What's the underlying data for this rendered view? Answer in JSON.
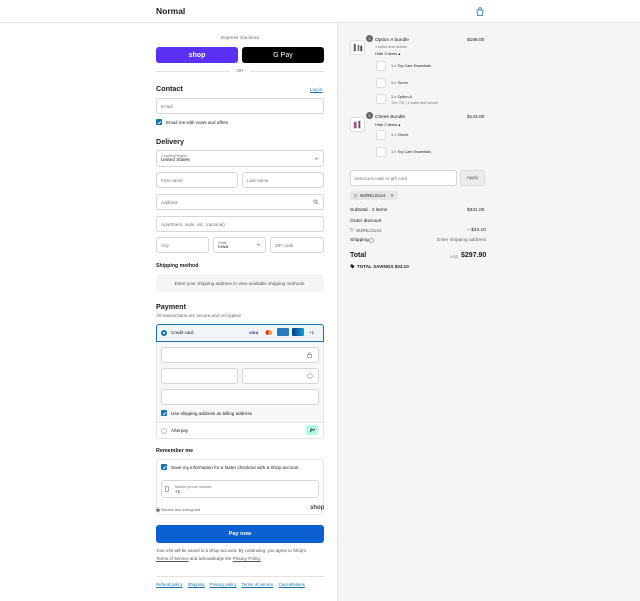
{
  "header": {
    "store_name": "Normal"
  },
  "express": {
    "label": "Express checkout",
    "shop_label": "shop",
    "gpay_label": "G Pay",
    "or_label": "OR"
  },
  "contact": {
    "title": "Contact",
    "login_label": "Log in",
    "email_placeholder": "Email",
    "news_label": "Email me with news and offers"
  },
  "delivery": {
    "title": "Delivery",
    "country_label": "Country/Region",
    "country_value": "United States",
    "first_name": "First name",
    "last_name": "Last name",
    "address": "Address",
    "apartment": "Apartment, suite, etc. (optional)",
    "city": "City",
    "state_label": "State",
    "state_value": "Iowa",
    "zip": "ZIP code"
  },
  "shipping": {
    "title": "Shipping method",
    "notice": "Enter your shipping address to view available shipping methods."
  },
  "payment": {
    "title": "Payment",
    "subtitle": "All transactions are secure and encrypted.",
    "credit_card_label": "Credit card",
    "visa": "VISA",
    "more_cards": "+1",
    "billing_label": "Use shipping address as billing address",
    "afterpay_label": "Afterpay"
  },
  "remember": {
    "title": "Remember me",
    "save_label": "Save my information for a faster checkout with a Shop account",
    "phone_label": "Mobile phone number",
    "phone_value": "+1",
    "secure_label": "Secure and encrypted",
    "shop_label": "shop"
  },
  "pay_button": "Pay now",
  "terms": {
    "line1": "Your info will be saved to a Shop account. By continuing, you agree to Shop's",
    "terms_link": "Terms of Service",
    "and_text": "and acknowledge the",
    "privacy_link": "Privacy Policy."
  },
  "footer_links": [
    "Refund policy",
    "Shipping",
    "Privacy policy",
    "Terms of service",
    "Cancellations"
  ],
  "summary": {
    "items": [
      {
        "name": "Option A bundle",
        "variant": "1 bullet and nehole",
        "toggle": "Hide 3 items",
        "price": "$188.00",
        "qty": "1",
        "sub_items": [
          {
            "text": "1 × Toy Care Essentials",
            "sub": ""
          },
          {
            "text": "1 × Gunm",
            "sub": ""
          },
          {
            "text": "1 × Option A",
            "sub": "The CIG | 1 bullet and nehole"
          }
        ]
      },
      {
        "name": "Cheek Bundle",
        "variant": "",
        "toggle": "Hide 2 items",
        "price": "$143.00",
        "qty": "1",
        "sub_items": [
          {
            "text": "1 × Cheek",
            "sub": ""
          },
          {
            "text": "1 × Toy Care Essentials",
            "sub": ""
          }
        ]
      }
    ],
    "discount_placeholder": "Discount code or gift card",
    "apply_label": "Apply",
    "code_chip": "WJRKLS144",
    "subtotal_label": "Subtotal · 2 items",
    "subtotal_value": "$331.00",
    "order_discount_label": "Order discount",
    "discount_code": "WJRKLS144",
    "discount_value": "− $33.10",
    "shipping_label": "Shipping",
    "shipping_value": "Enter shipping address",
    "total_label": "Total",
    "currency": "USD",
    "total_value": "$297.90",
    "savings_label": "TOTAL SAVINGS",
    "savings_value": "$33.10"
  },
  "colors": {
    "accent": "#1773b0",
    "shop_purple": "#5a31f4",
    "pay_button": "#0b5fd1"
  }
}
